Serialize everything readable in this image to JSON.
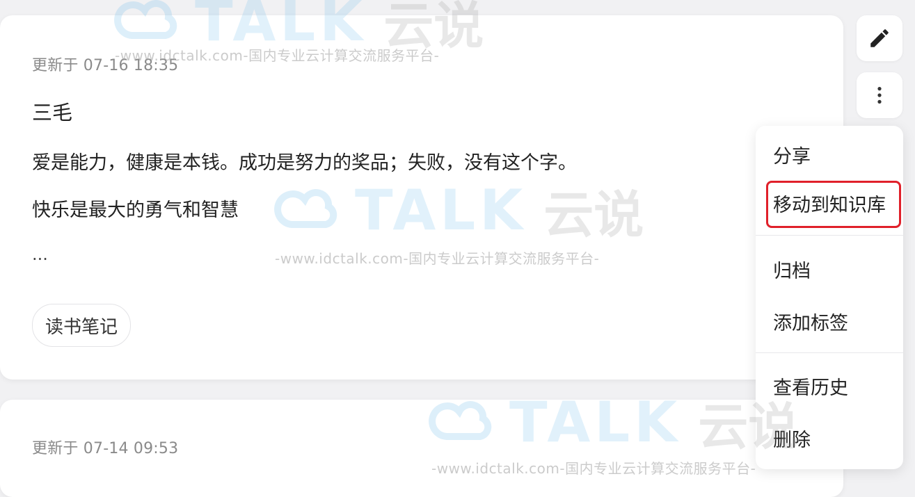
{
  "cards": [
    {
      "updated": "更新于 07-16 18:35",
      "title": "三毛",
      "lines": [
        "爱是能力，健康是本钱。成功是努力的奖品；失败，没有这个字。",
        "快乐是最大的勇气和智慧"
      ],
      "ellipsis": "...",
      "tag": "读书笔记"
    },
    {
      "updated": "更新于 07-14 09:53"
    }
  ],
  "actions": {
    "edit_icon": "pencil-icon",
    "more_icon": "more-vertical-icon"
  },
  "menu": {
    "items": [
      "分享",
      "移动到知识库",
      "归档",
      "添加标签",
      "查看历史",
      "删除"
    ],
    "highlighted_index": 1,
    "highlight_color": "#e0202a"
  },
  "watermark": {
    "brand": "TALK",
    "brand_cn": "云说",
    "subtitle": "-www.idctalk.com-国内专业云计算交流服务平台-"
  }
}
